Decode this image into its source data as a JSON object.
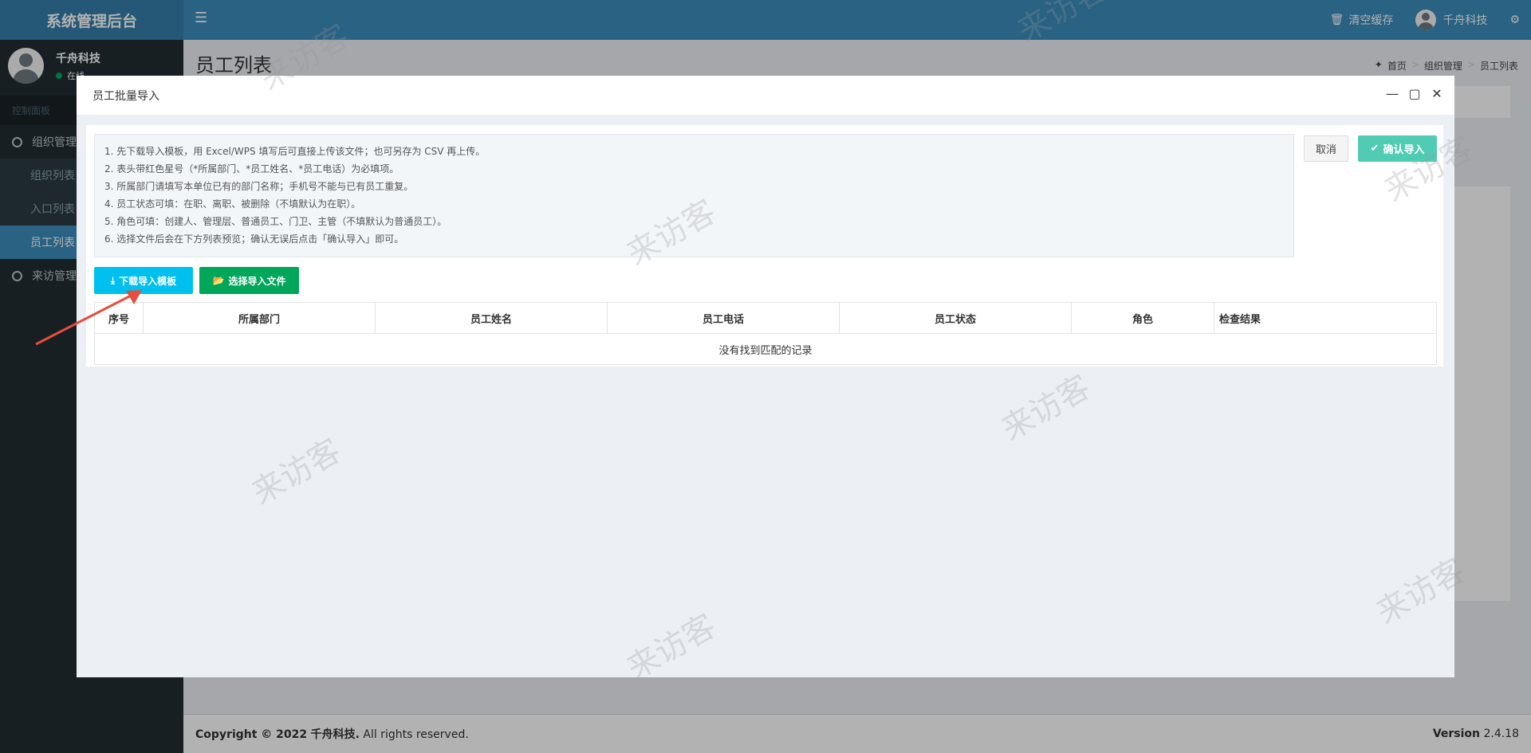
{
  "app": {
    "title": "系统管理后台",
    "menu_icon": "hamburger-icon"
  },
  "topbar": {
    "clear_cache": "清空缓存",
    "user": "千舟科技"
  },
  "sidebar": {
    "user_name": "千舟科技",
    "user_status": "在线",
    "header": "控制面板",
    "items": [
      {
        "label": "组织管理"
      },
      {
        "label": "组织列表"
      },
      {
        "label": "入口列表"
      },
      {
        "label": "员工列表"
      },
      {
        "label": "来访管理"
      }
    ]
  },
  "page": {
    "title": "员工列表"
  },
  "breadcrumb": [
    "首页",
    "组织管理",
    "员工列表"
  ],
  "footer": {
    "copyright_prefix": "Copyright © 2022",
    "company": "千舟科技.",
    "rights": "All rights reserved.",
    "version_label": "Version",
    "version": "2.4.18"
  },
  "modal": {
    "title": "员工批量导入",
    "tips": [
      "1. 先下载导入模板，用 Excel/WPS 填写后可直接上传该文件；也可另存为 CSV 再上传。",
      "2. 表头带红色星号（*所属部门、*员工姓名、*员工电话）为必填项。",
      "3. 所属部门请填写本单位已有的部门名称；手机号不能与已有员工重复。",
      "4. 员工状态可填：在职、离职、被删除（不填默认为在职）。",
      "5. 角色可填：创建人、管理层、普通员工、门卫、主管（不填默认为普通员工）。",
      "6. 选择文件后会在下方列表预览；确认无误后点击「确认导入」即可。"
    ],
    "cancel": "取消",
    "confirm": "确认导入",
    "download": "下载导入模板",
    "select": "选择导入文件",
    "columns": [
      "序号",
      "所属部门",
      "员工姓名",
      "员工电话",
      "员工状态",
      "角色",
      "检查结果"
    ],
    "empty": "没有找到匹配的记录"
  },
  "watermark": "来访客",
  "colors": {
    "topbar": "#3c8dbc",
    "sidebar": "#222d32",
    "info": "#00c0ef",
    "success": "#00a65a",
    "confirm": "#18bc9c",
    "arrow": "#e74c3c"
  }
}
